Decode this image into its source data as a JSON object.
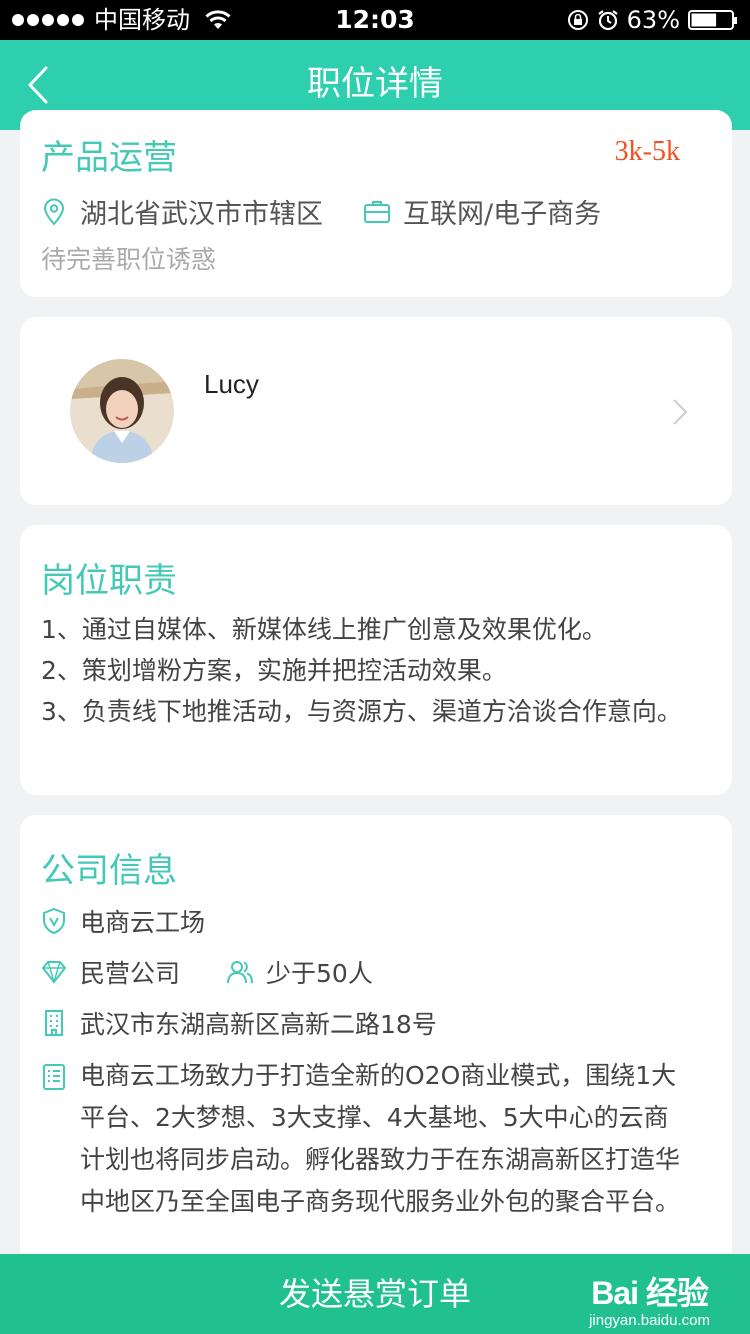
{
  "status_bar": {
    "carrier": "中国移动",
    "time": "12:03",
    "battery": "63%",
    "battery_level": 0.63
  },
  "nav": {
    "title": "职位详情"
  },
  "job": {
    "title": "产品运营",
    "salary": "3k-5k",
    "location": "湖北省武汉市市辖区",
    "industry": "互联网/电子商务",
    "perk": "待完善职位诱惑"
  },
  "contact": {
    "name": "Lucy"
  },
  "duties": {
    "title": "岗位职责",
    "items": [
      "1、通过自媒体、新媒体线上推广创意及效果优化。",
      "2、策划增粉方案，实施并把控活动效果。",
      "3、负责线下地推活动，与资源方、渠道方洽谈合作意向。"
    ]
  },
  "company": {
    "title": "公司信息",
    "name": "电商云工场",
    "type": "民营公司",
    "size": "少于50人",
    "address": "武汉市东湖高新区高新二路18号",
    "description": "电商云工场致力于打造全新的O2O商业模式，围绕1大平台、2大梦想、3大支撑、4大基地、5大中心的云商计划也将同步启动。孵化器致力于在东湖高新区打造华中地区乃至全国电子商务现代服务业外包的聚合平台。"
  },
  "action": {
    "label": "发送悬赏订单"
  },
  "watermark": {
    "logo_text": "Bai 经验",
    "url": "jingyan.baidu.com"
  },
  "colors": {
    "accent": "#2ecfae",
    "title_teal": "#44c8b7",
    "salary": "#f0501e",
    "button": "#20c08f"
  }
}
